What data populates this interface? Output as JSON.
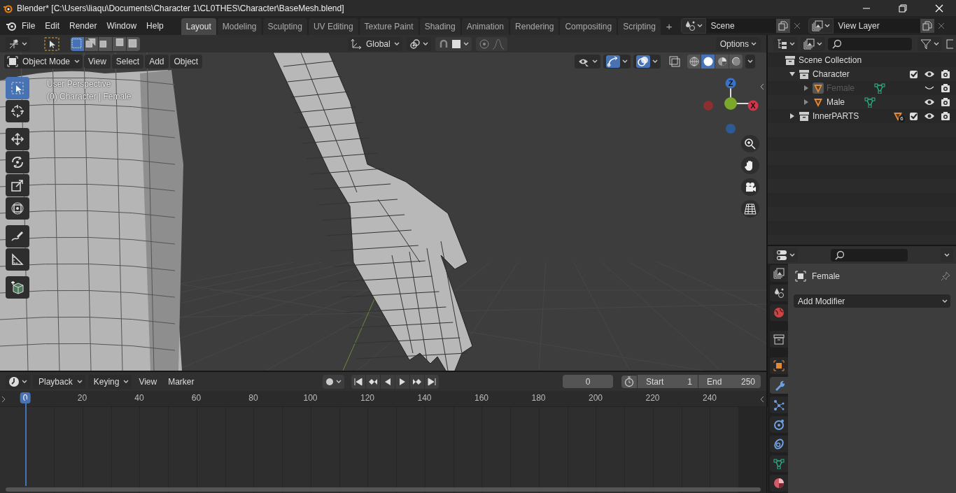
{
  "window": {
    "title": "Blender* [C:\\Users\\liaqu\\Documents\\Character 1\\CL0THES\\Character\\BaseMesh.blend]"
  },
  "menu": [
    "File",
    "Edit",
    "Render",
    "Window",
    "Help"
  ],
  "workspaces": [
    {
      "label": "Layout",
      "selected": true
    },
    {
      "label": "Modeling",
      "selected": false
    },
    {
      "label": "Sculpting",
      "selected": false
    },
    {
      "label": "UV Editing",
      "selected": false
    },
    {
      "label": "Texture Paint",
      "selected": false
    },
    {
      "label": "Shading",
      "selected": false
    },
    {
      "label": "Animation",
      "selected": false
    },
    {
      "label": "Rendering",
      "selected": false
    },
    {
      "label": "Compositing",
      "selected": false
    },
    {
      "label": "Scripting",
      "selected": false
    }
  ],
  "add_workspace": "+",
  "scene": "Scene",
  "view_layer": "View Layer",
  "tool_header": {
    "orientation": "Global",
    "options": "Options"
  },
  "viewport_header": {
    "mode": "Object Mode",
    "menus": [
      "View",
      "Select",
      "Add",
      "Object"
    ],
    "shading": [
      {
        "kind": "wireframe",
        "selected": false
      },
      {
        "kind": "solid",
        "selected": true
      },
      {
        "kind": "material",
        "selected": false
      },
      {
        "kind": "rendered",
        "selected": false
      }
    ]
  },
  "viewport_info": [
    "User Perspective",
    "(0) Character | Female"
  ],
  "tools": [
    {
      "kind": "select",
      "selected": true
    },
    {
      "kind": "cursor",
      "selected": false
    },
    {
      "kind": "move",
      "selected": false
    },
    {
      "kind": "rotate",
      "selected": false
    },
    {
      "kind": "scale",
      "selected": false
    },
    {
      "kind": "transform",
      "selected": false
    },
    {
      "kind": "annotate",
      "selected": false
    },
    {
      "kind": "measure",
      "selected": false
    },
    {
      "kind": "add-cube",
      "selected": false
    }
  ],
  "gizmo_labels": [
    "Z",
    "X"
  ],
  "outliner": {
    "items": [
      {
        "label": "Scene Collection",
        "kind": "scene",
        "children": [
          {
            "label": "Character",
            "kind": "collection",
            "expanded": true,
            "checked": true,
            "visible": true,
            "children": [
              {
                "label": "Female",
                "kind": "object",
                "expanded": false,
                "visible": false
              },
              {
                "label": "Male",
                "kind": "object",
                "expanded": false,
                "visible": true
              }
            ]
          },
          {
            "label": "InnerPARTS",
            "kind": "collection",
            "expanded": false,
            "checked": true,
            "visible": true,
            "badge": "6"
          }
        ]
      }
    ]
  },
  "properties": {
    "tabs": [
      {
        "kind": "view-layer",
        "selected": false
      },
      {
        "kind": "scene",
        "selected": false
      },
      {
        "kind": "world",
        "selected": false
      },
      {
        "kind": "collection",
        "selected": false
      },
      {
        "kind": "object",
        "selected": false
      },
      {
        "kind": "modifier",
        "selected": true
      },
      {
        "kind": "particles",
        "selected": false
      },
      {
        "kind": "physics",
        "selected": false
      },
      {
        "kind": "constraints",
        "selected": false
      },
      {
        "kind": "data",
        "selected": false
      },
      {
        "kind": "material",
        "selected": false
      }
    ],
    "object": "Female",
    "add_modifier": "Add Modifier"
  },
  "timeline": {
    "menus": [
      "Playback",
      "Keying",
      "View",
      "Marker"
    ],
    "current_frame": "0",
    "start": {
      "label": "Start",
      "value": "1"
    },
    "end": {
      "label": "End",
      "value": "250"
    },
    "ruler": [
      "0",
      "20",
      "40",
      "60",
      "80",
      "100",
      "120",
      "140",
      "160",
      "180",
      "200",
      "220",
      "240"
    ]
  }
}
